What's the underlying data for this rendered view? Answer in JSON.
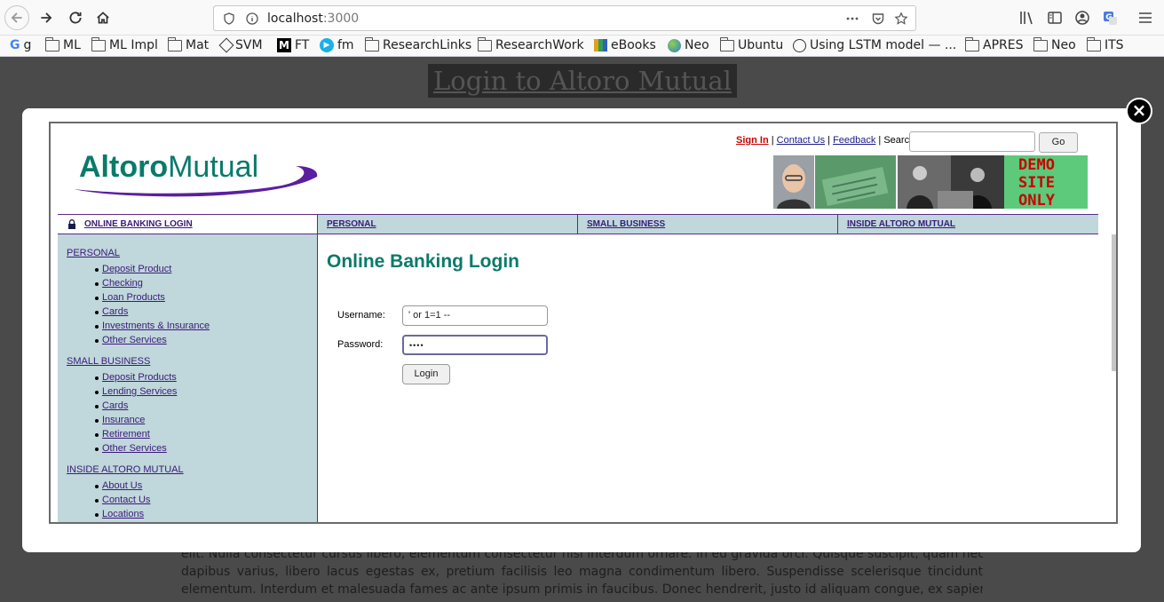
{
  "browser": {
    "url_host": "localhost",
    "url_port": ":3000",
    "bookmarks": [
      {
        "label": "g",
        "icon": "google-icon"
      },
      {
        "label": "ML",
        "icon": "folder-icon"
      },
      {
        "label": "ML Impl",
        "icon": "folder-icon"
      },
      {
        "label": "Mat",
        "icon": "folder-icon"
      },
      {
        "label": "SVM",
        "icon": "svm-icon"
      },
      {
        "label": "FT",
        "icon": "medium-icon"
      },
      {
        "label": "fm",
        "icon": "play-icon"
      },
      {
        "label": "ResearchLinks",
        "icon": "folder-icon"
      },
      {
        "label": "ResearchWork",
        "icon": "folder-icon"
      },
      {
        "label": "eBooks",
        "icon": "ebooks-icon"
      },
      {
        "label": "Neo",
        "icon": "neo-icon"
      },
      {
        "label": "Ubuntu",
        "icon": "folder-icon"
      },
      {
        "label": "Using LSTM model — ...",
        "icon": "globe-icon"
      },
      {
        "label": "APRES",
        "icon": "folder-icon"
      },
      {
        "label": "Neo",
        "icon": "folder-icon"
      },
      {
        "label": "ITS",
        "icon": "folder-icon"
      }
    ]
  },
  "background_page": {
    "title": "Login to Altoro Mutual",
    "para_lines": [
      "elit. Nulla consectetur cursus libero, elementum consectetur nisi interdum ornare. In eu gravida orci. Quisque suscipit, quam nec",
      "dapibus varius, libero lacus egestas ex, pretium facilisis leo magna condimentum libero. Suspendisse scelerisque tincidunt",
      "elementum. Interdum et malesuada fames ac ante ipsum primis in faucibus. Donec hendrerit, justo id aliquam congue, ex sapien"
    ]
  },
  "modal": {
    "close_label": "×"
  },
  "altoro": {
    "logo_text_altoro": "Altoro",
    "logo_text_mutual": "Mutual",
    "top_links": {
      "sign_in": "Sign In",
      "sep1": " | ",
      "contact": "Contact Us",
      "sep2": " | ",
      "feedback": "Feedback",
      "search_label": " | Search"
    },
    "go_label": "Go",
    "demo_lines": [
      "DEMO",
      "SITE",
      "ONLY"
    ],
    "nav": {
      "online_banking": "ONLINE BANKING LOGIN",
      "personal": "PERSONAL",
      "small_business": "SMALL BUSINESS",
      "inside": "INSIDE ALTORO MUTUAL"
    },
    "sidebar": {
      "personal": {
        "heading": "PERSONAL",
        "items": [
          "Deposit Product",
          "Checking",
          "Loan Products",
          "Cards",
          "Investments & Insurance",
          "Other Services"
        ]
      },
      "small_business": {
        "heading": "SMALL BUSINESS",
        "items": [
          "Deposit Products",
          "Lending Services",
          "Cards",
          "Insurance",
          "Retirement",
          "Other Services"
        ]
      },
      "inside": {
        "heading": "INSIDE ALTORO MUTUAL",
        "items": [
          "About Us",
          "Contact Us",
          "Locations"
        ]
      }
    },
    "login": {
      "title": "Online Banking Login",
      "username_label": "Username:",
      "username_value": "' or 1=1 --",
      "password_label": "Password:",
      "password_mask": "••••",
      "login_button": "Login"
    },
    "colors": {
      "brand_teal": "#0a7a6a",
      "brand_purple": "#5a1fa0",
      "sidebar_bg": "#c0d7db",
      "demo_bg": "#5dc97a",
      "demo_text": "#cc0000"
    }
  }
}
